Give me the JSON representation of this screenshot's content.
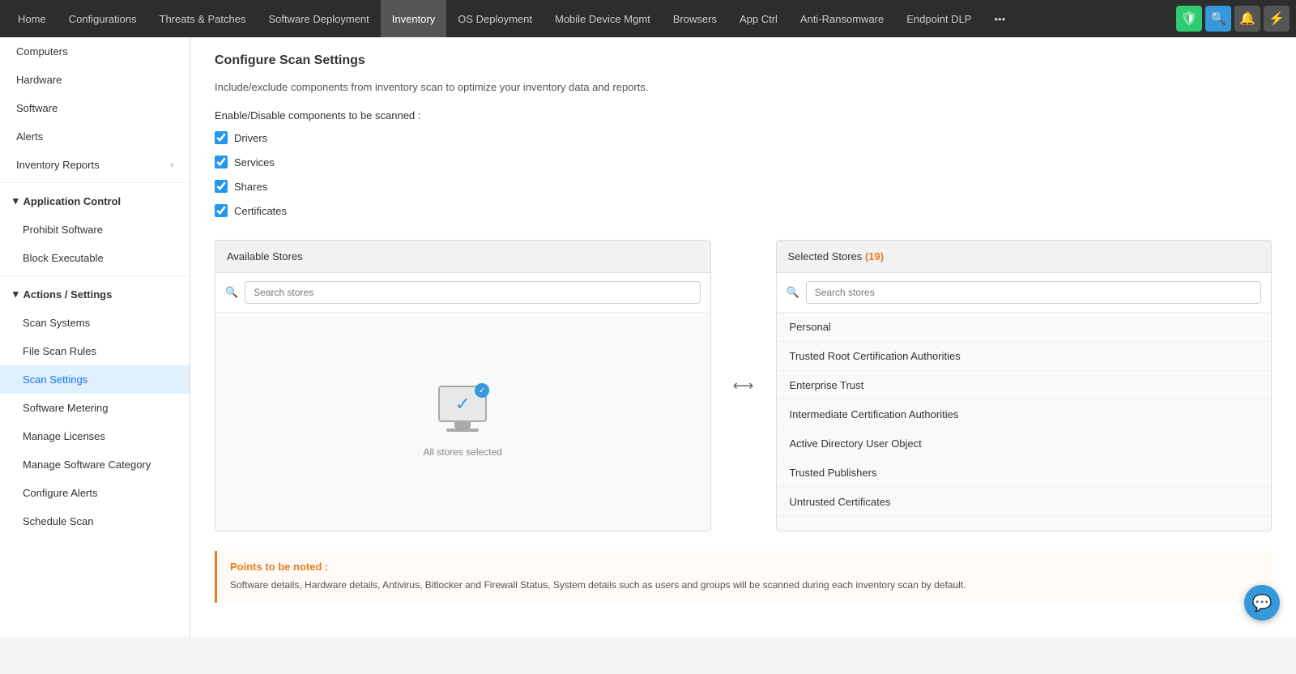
{
  "nav": {
    "items": [
      {
        "label": "Home",
        "active": false
      },
      {
        "label": "Configurations",
        "active": false
      },
      {
        "label": "Threats & Patches",
        "active": false
      },
      {
        "label": "Software Deployment",
        "active": false
      },
      {
        "label": "Inventory",
        "active": true
      },
      {
        "label": "OS Deployment",
        "active": false
      },
      {
        "label": "Mobile Device Mgmt",
        "active": false
      },
      {
        "label": "Browsers",
        "active": false
      },
      {
        "label": "App Ctrl",
        "active": false
      },
      {
        "label": "Anti-Ransomware",
        "active": false
      },
      {
        "label": "Endpoint DLP",
        "active": false
      },
      {
        "label": "•••",
        "active": false
      }
    ]
  },
  "sidebar": {
    "items": [
      {
        "label": "Computers",
        "type": "item",
        "indent": false
      },
      {
        "label": "Hardware",
        "type": "item",
        "indent": false
      },
      {
        "label": "Software",
        "type": "item",
        "indent": false
      },
      {
        "label": "Alerts",
        "type": "item",
        "indent": false
      },
      {
        "label": "Inventory Reports",
        "type": "item-arrow",
        "indent": false
      },
      {
        "label": "Application Control",
        "type": "section",
        "indent": false
      },
      {
        "label": "Prohibit Software",
        "type": "item",
        "indent": true
      },
      {
        "label": "Block Executable",
        "type": "item",
        "indent": true
      },
      {
        "label": "Actions / Settings",
        "type": "section",
        "indent": false
      },
      {
        "label": "Scan Systems",
        "type": "item",
        "indent": true
      },
      {
        "label": "File Scan Rules",
        "type": "item",
        "indent": true
      },
      {
        "label": "Scan Settings",
        "type": "item-active",
        "indent": true
      },
      {
        "label": "Software Metering",
        "type": "item",
        "indent": true
      },
      {
        "label": "Manage Licenses",
        "type": "item",
        "indent": true
      },
      {
        "label": "Manage Software Category",
        "type": "item",
        "indent": true
      },
      {
        "label": "Configure Alerts",
        "type": "item",
        "indent": true
      },
      {
        "label": "Schedule Scan",
        "type": "item",
        "indent": true
      }
    ]
  },
  "main": {
    "page_title": "Configure Scan Settings",
    "subtitle": "Include/exclude components from inventory scan to optimize your inventory data and reports.",
    "components_label": "Enable/Disable components to be scanned :",
    "checkboxes": [
      {
        "label": "Drivers",
        "checked": true
      },
      {
        "label": "Services",
        "checked": true
      },
      {
        "label": "Shares",
        "checked": true
      },
      {
        "label": "Certificates",
        "checked": true
      }
    ],
    "available_stores": {
      "header": "Available Stores",
      "search_placeholder": "Search stores",
      "empty_text": "All stores selected"
    },
    "selected_stores": {
      "header": "Selected Stores",
      "count": "(19)",
      "search_placeholder": "Search stores",
      "items": [
        "Personal",
        "Trusted Root Certification Authorities",
        "Enterprise Trust",
        "Intermediate Certification Authorities",
        "Active Directory User Object",
        "Trusted Publishers",
        "Untrusted Certificates"
      ]
    },
    "notes": {
      "title": "Points to be noted :",
      "text": "Software details, Hardware details, Antivirus, Bitlocker and Firewall Status, System details such as users and groups will be scanned during each inventory scan by default."
    }
  }
}
